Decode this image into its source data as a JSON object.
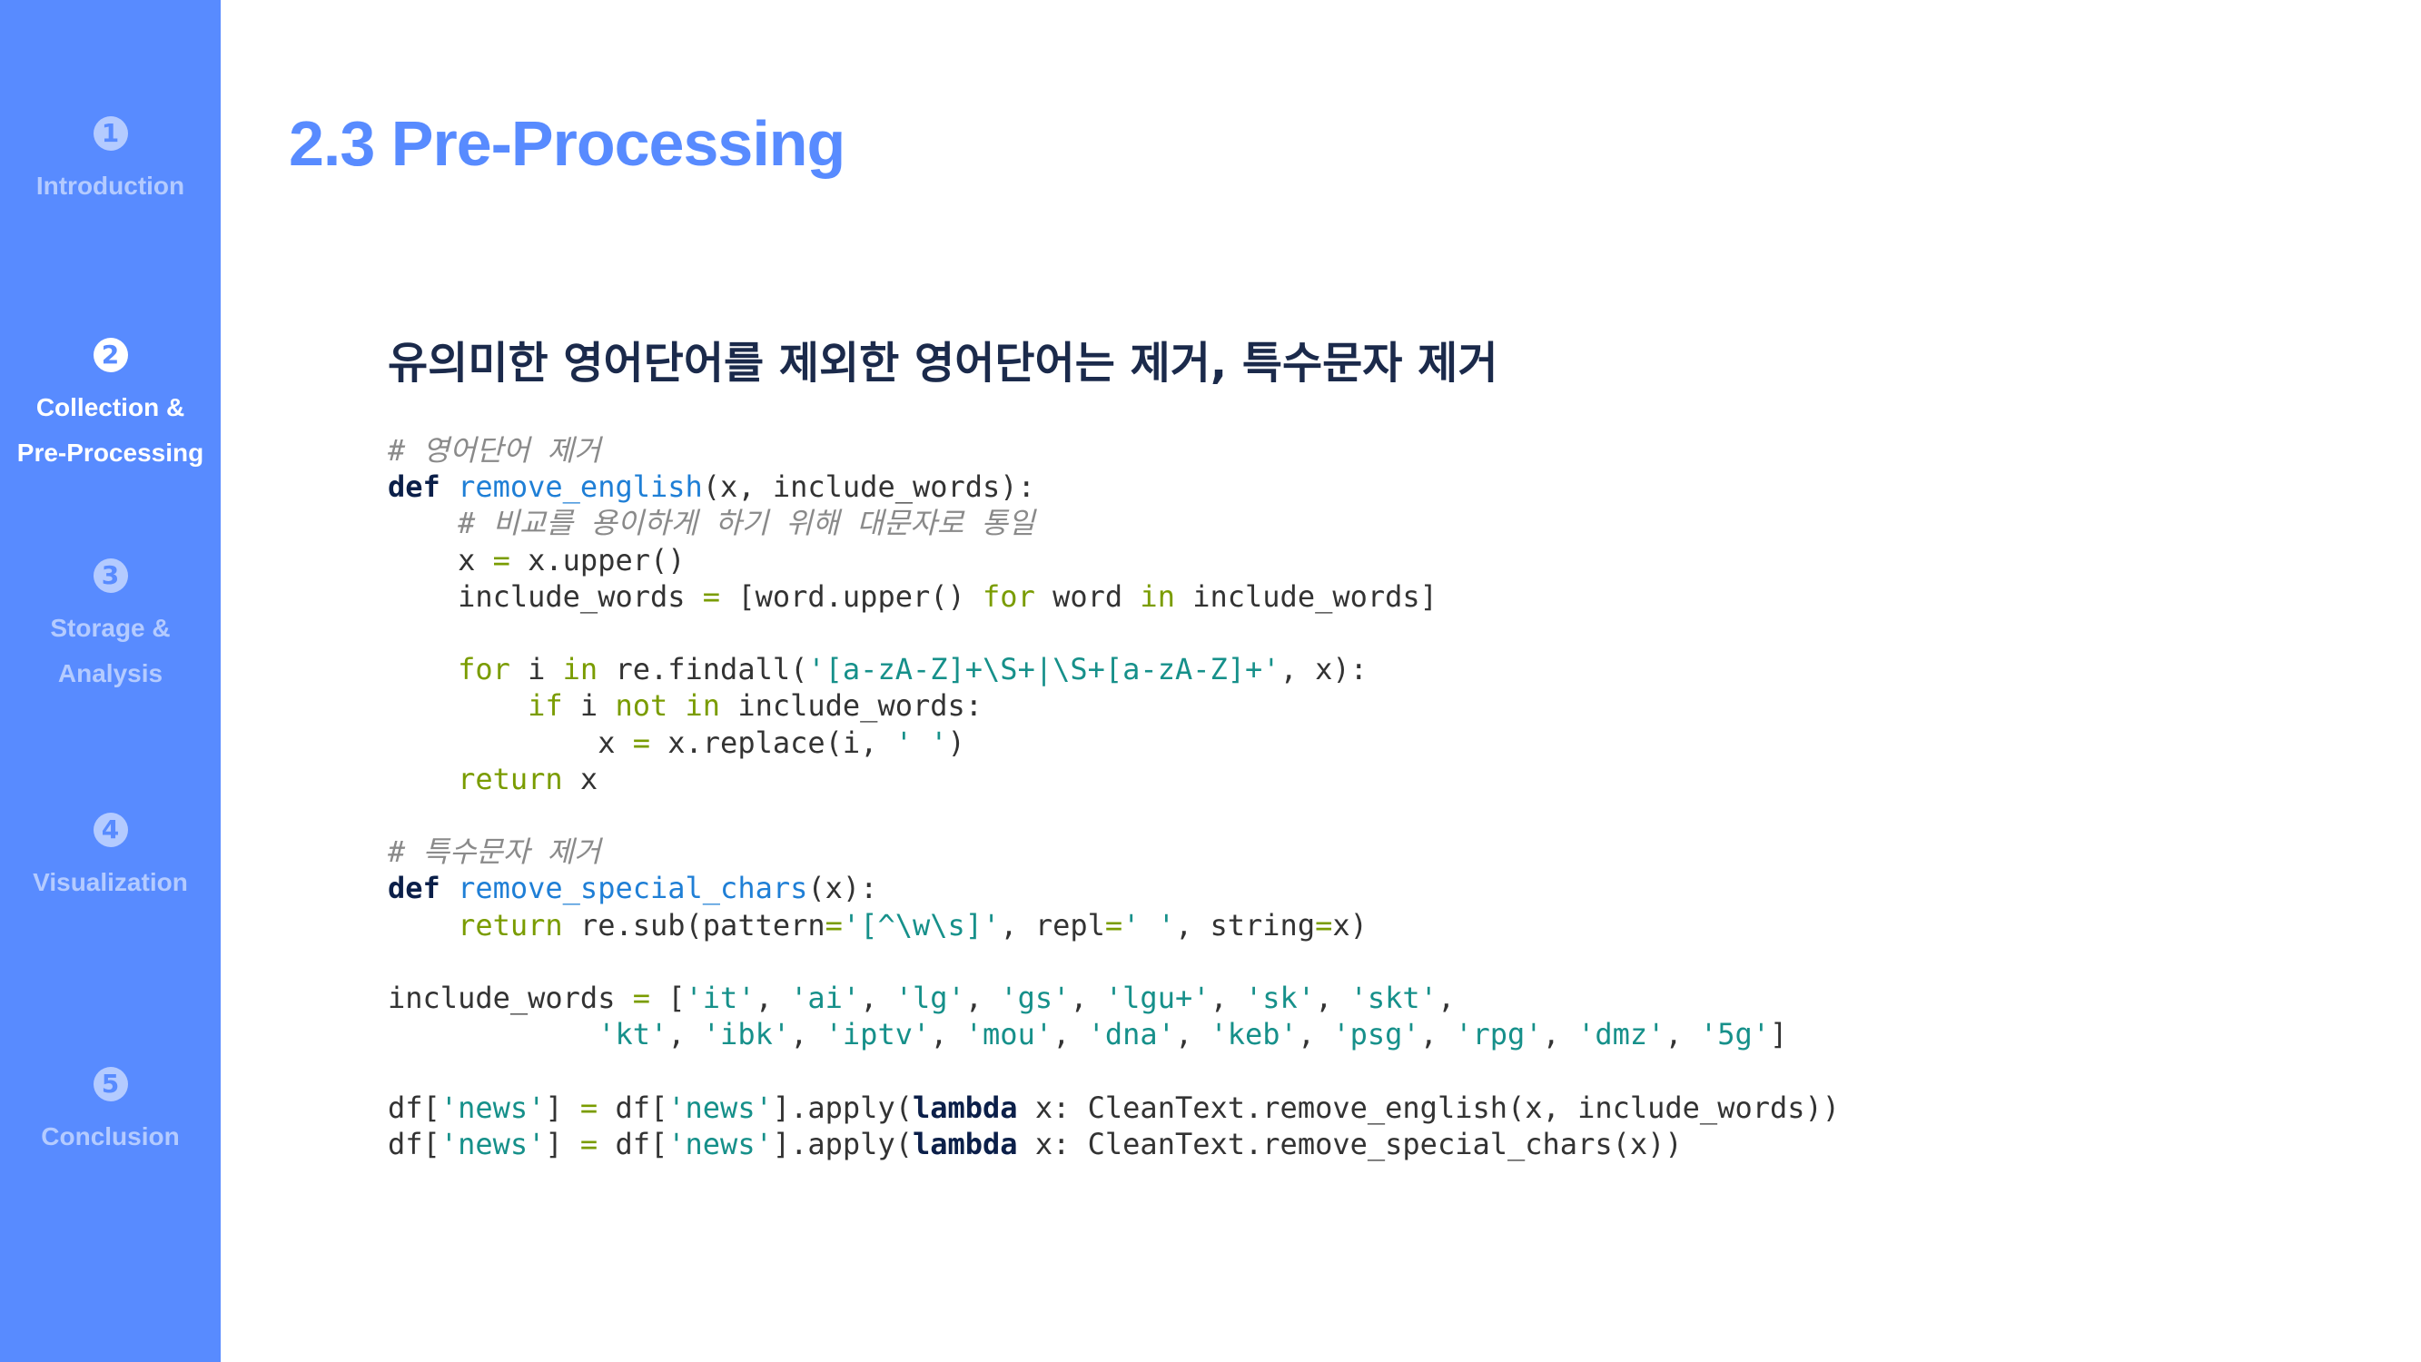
{
  "sidebar": {
    "items": [
      {
        "number": "1",
        "label": "Introduction"
      },
      {
        "number": "2",
        "label": "Collection &\nPre-Processing"
      },
      {
        "number": "3",
        "label": "Storage &\nAnalysis"
      },
      {
        "number": "4",
        "label": "Visualization"
      },
      {
        "number": "5",
        "label": "Conclusion"
      }
    ],
    "active_index": 1
  },
  "slide": {
    "title": "2.3 Pre-Processing",
    "subtitle": "유의미한 영어단어를 제외한 영어단어는 제거, 특수문자 제거"
  },
  "code": {
    "language": "python",
    "lines": [
      "# 영어단어 제거",
      "def remove_english(x, include_words):",
      "    # 비교를 용이하게 하기 위해 대문자로 통일",
      "    x = x.upper()",
      "    include_words = [word.upper() for word in include_words]",
      "",
      "    for i in re.findall('[a-zA-Z]+\\S+|\\S+[a-zA-Z]+', x):",
      "        if i not in include_words:",
      "            x = x.replace(i, ' ')",
      "    return x",
      "",
      "# 특수문자 제거",
      "def remove_special_chars(x):",
      "    return re.sub(pattern='[^\\w\\s]', repl=' ', string=x)",
      "",
      "include_words = ['it', 'ai', 'lg', 'gs', 'lgu+', 'sk', 'skt',",
      "            'kt', 'ibk', 'iptv', 'mou', 'dna', 'keb', 'psg', 'rpg', 'dmz', '5g']",
      "",
      "df['news'] = df['news'].apply(lambda x: CleanText.remove_english(x, include_words))",
      "df['news'] = df['news'].apply(lambda x: CleanText.remove_special_chars(x))"
    ]
  },
  "colors": {
    "sidebar_bg": "#588bff",
    "sidebar_inactive": "#b4cbff",
    "sidebar_active": "#ffffff",
    "title": "#588bff",
    "subtitle": "#1b2a4b",
    "code_comment": "#8a8a8a",
    "code_keyword": "#0b1f49",
    "code_function": "#1f7fd6",
    "code_control": "#7a9c00",
    "code_string": "#16908a"
  }
}
